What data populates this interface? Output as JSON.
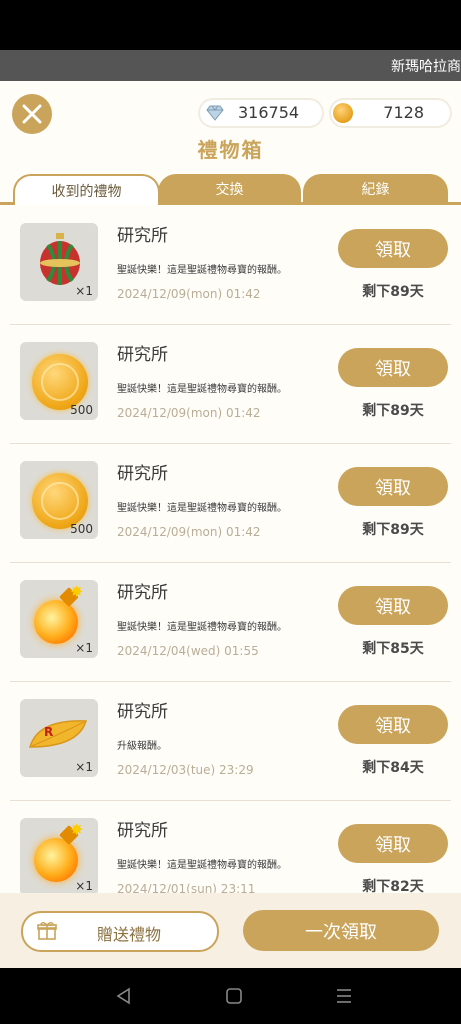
{
  "marquee": {
    "text": "新瑪哈拉商"
  },
  "currency": {
    "gems": "316754",
    "coins": "7128"
  },
  "title": "禮物箱",
  "tabs": [
    {
      "label": "收到的禮物"
    },
    {
      "label": "交換"
    },
    {
      "label": "紀錄"
    }
  ],
  "gifts": [
    {
      "sender": "研究所",
      "message": "聖誕快樂！這是聖誕禮物尋寶的報酬。",
      "date": "2024/12/09(mon) 01:42",
      "qty": "×1",
      "item_icon": "ornament-icon",
      "claim": "領取",
      "remaining": "剩下89天"
    },
    {
      "sender": "研究所",
      "message": "聖誕快樂！這是聖誕禮物尋寶的報酬。",
      "date": "2024/12/09(mon) 01:42",
      "qty": "500",
      "item_icon": "gold-coin-icon",
      "claim": "領取",
      "remaining": "剩下89天"
    },
    {
      "sender": "研究所",
      "message": "聖誕快樂！這是聖誕禮物尋寶的報酬。",
      "date": "2024/12/09(mon) 01:42",
      "qty": "500",
      "item_icon": "gold-coin-icon",
      "claim": "領取",
      "remaining": "剩下89天"
    },
    {
      "sender": "研究所",
      "message": "聖誕快樂！這是聖誕禮物尋寶的報酬。",
      "date": "2024/12/04(wed) 01:55",
      "qty": "×1",
      "item_icon": "bomb-icon",
      "claim": "領取",
      "remaining": "剩下85天"
    },
    {
      "sender": "研究所",
      "message": "升級報酬。",
      "date": "2024/12/03(tue) 23:29",
      "qty": "×1",
      "item_icon": "leaf-ticket-icon",
      "claim": "領取",
      "remaining": "剩下84天"
    },
    {
      "sender": "研究所",
      "message": "聖誕快樂！這是聖誕禮物尋寶的報酬。",
      "date": "2024/12/01(sun) 23:11",
      "qty": "×1",
      "item_icon": "bomb-icon",
      "claim": "領取",
      "remaining": "剩下82天"
    }
  ],
  "footer": {
    "send_label": "贈送禮物",
    "claim_all_label": "一次領取"
  },
  "colors": {
    "accent": "#c9a45a",
    "background": "#fffdf8"
  }
}
